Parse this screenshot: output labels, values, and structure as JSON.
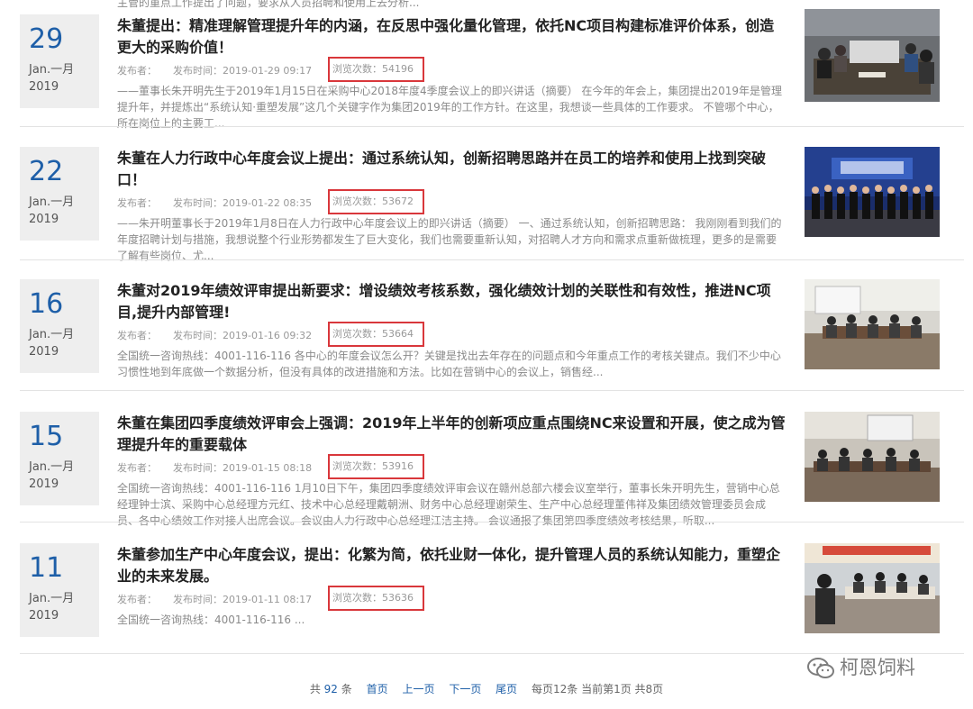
{
  "top_snippet": "主管的重点工作提出了问题，要求从人员招聘和使用上去分析...",
  "labels": {
    "publisher": "发布者：",
    "pubtime_prefix": "发布时间：",
    "views_prefix": "浏览次数："
  },
  "items": [
    {
      "day": "29",
      "month": "Jan.一月",
      "year": "2019",
      "title": "朱董提出：精准理解管理提升年的内涵，在反思中强化量化管理，依托NC项目构建标准评价体系，创造更大的采购价值！",
      "time": "2019-01-29 09:17",
      "views": "54196",
      "summary": "——董事长朱开明先生于2019年1月15日在采购中心2018年度4季度会议上的即兴讲话（摘要） 在今年的年会上，集团提出2019年是管理提升年，并提炼出“系统认知·重塑发展”这几个关键字作为集团2019年的工作方针。在这里，我想谈一些具体的工作要求。 不管哪个中心，所在岗位上的主要工..."
    },
    {
      "day": "22",
      "month": "Jan.一月",
      "year": "2019",
      "title": "朱董在人力行政中心年度会议上提出：通过系统认知，创新招聘思路并在员工的培养和使用上找到突破口！",
      "time": "2019-01-22 08:35",
      "views": "53672",
      "summary": "——朱开明董事长于2019年1月8日在人力行政中心年度会议上的即兴讲话（摘要） 一、通过系统认知，创新招聘思路： 我刚刚看到我们的年度招聘计划与措施，我想说整个行业形势都发生了巨大变化，我们也需要重新认知，对招聘人才方向和需求点重新做梳理，更多的是需要了解有些岗位、尤..."
    },
    {
      "day": "16",
      "month": "Jan.一月",
      "year": "2019",
      "title": "朱董对2019年绩效评审提出新要求：增设绩效考核系数，强化绩效计划的关联性和有效性，推进NC项目,提升内部管理!",
      "time": "2019-01-16 09:32",
      "views": "53664",
      "summary": "全国统一咨询热线：4001-116-116 各中心的年度会议怎么开？关键是找出去年存在的问题点和今年重点工作的考核关键点。我们不少中心习惯性地到年底做一个数据分析，但没有具体的改进措施和方法。比如在营销中心的会议上，销售经..."
    },
    {
      "day": "15",
      "month": "Jan.一月",
      "year": "2019",
      "title": "朱董在集团四季度绩效评审会上强调：2019年上半年的创新项应重点围绕NC来设置和开展，使之成为管理提升年的重要载体",
      "time": "2019-01-15 08:18",
      "views": "53916",
      "summary": "全国统一咨询热线：4001-116-116 1月10日下午，集团四季度绩效评审会议在赣州总部六楼会议室举行，董事长朱开明先生，营销中心总经理钟士滨、采购中心总经理方元红、技术中心总经理戴朝洲、财务中心总经理谢荣生、生产中心总经理董伟祥及集团绩效管理委员会成员、各中心绩效工作对接人出席会议。会议由人力行政中心总经理江洁主持。 会议通报了集团第四季度绩效考核结果，听取..."
    },
    {
      "day": "11",
      "month": "Jan.一月",
      "year": "2019",
      "title": "朱董参加生产中心年度会议，提出：化繁为简，依托业财一体化，提升管理人员的系统认知能力，重塑企业的未来发展。",
      "time": "2019-01-11 08:17",
      "views": "53636",
      "summary": "全国统一咨询热线：4001-116-116 ..."
    }
  ],
  "pagination": {
    "total_prefix": "共",
    "total": "92",
    "total_suffix": "条",
    "first": "首页",
    "prev": "上一页",
    "next": "下一页",
    "last": "尾页",
    "info": "每页12条 当前第1页 共8页"
  },
  "watermark": "柯恩饲料",
  "colors": {
    "accent": "#1e5fa8",
    "highlight_border": "#d9373b"
  }
}
